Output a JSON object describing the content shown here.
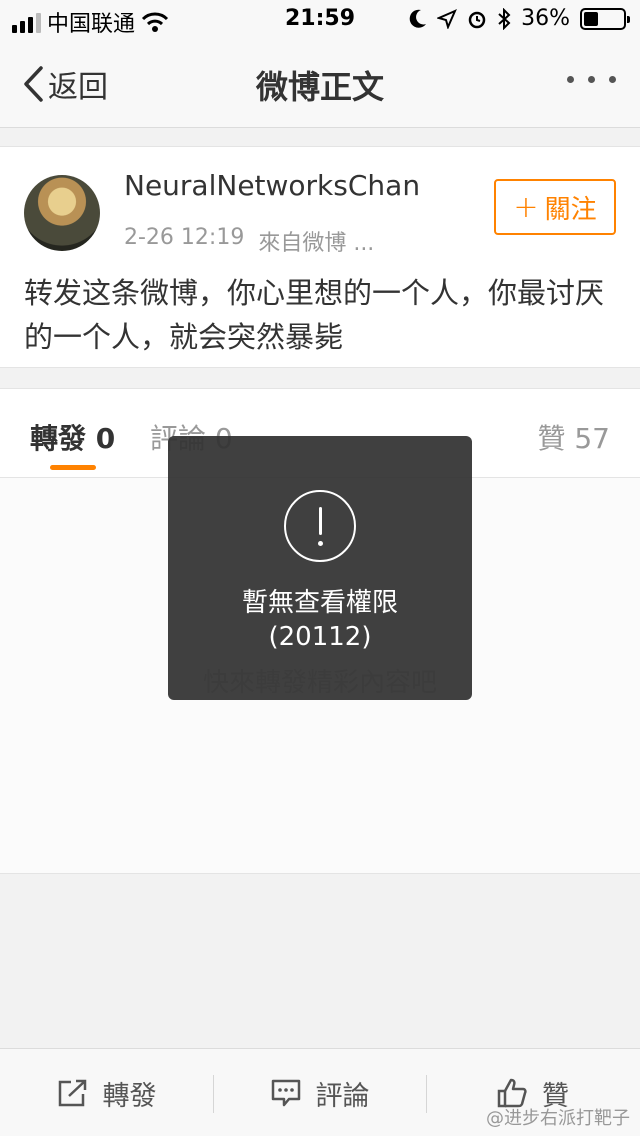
{
  "status_bar": {
    "carrier": "中国联通",
    "time": "21:59",
    "battery": "36%",
    "battery_level": 0.36
  },
  "nav": {
    "back_label": "返回",
    "title": "微博正文"
  },
  "post": {
    "username": "NeuralNetworksChan",
    "timestamp": "2-26 12:19",
    "source": "來自微博 ...",
    "follow_label": "關注",
    "text": "转发这条微博，你心里想的一个人，你最讨厌的一个人，就会突然暴毙"
  },
  "tabs": {
    "repost": "轉發 0",
    "comment": "評論 0",
    "like": "贊 57"
  },
  "content": {
    "empty_hint": "快來轉發精彩內容吧"
  },
  "toast": {
    "message_line1": "暫無查看權限",
    "message_line2": "(20112)"
  },
  "toolbar": {
    "repost_label": "轉發",
    "comment_label": "評論",
    "like_label": "贊"
  },
  "watermark": "@进步右派打靶子",
  "colors": {
    "accent": "#ff8200",
    "toast_bg": "#323232"
  }
}
